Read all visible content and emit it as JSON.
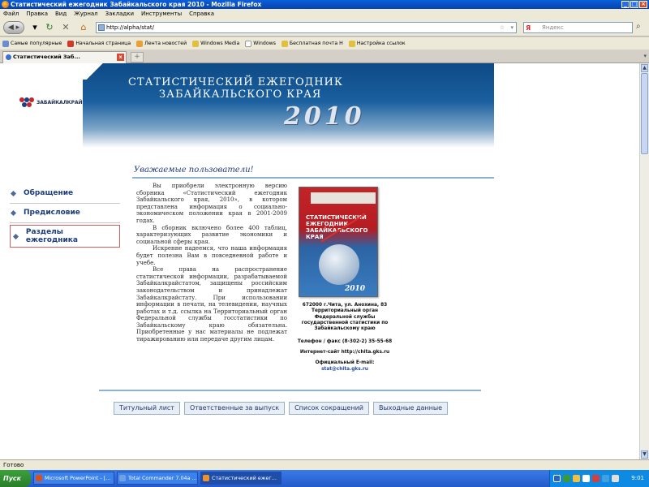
{
  "window": {
    "title": "Статистический ежегодник Забайкальского края 2010 - Mozilla Firefox"
  },
  "menu": [
    "Файл",
    "Правка",
    "Вид",
    "Журнал",
    "Закладки",
    "Инструменты",
    "Справка"
  ],
  "nav": {
    "url": "http://alpha/stat/",
    "search_placeholder": "Яндекс"
  },
  "bookmarks": [
    "Самые популярные",
    "Начальная страница",
    "Лента новостей",
    "Windows Media",
    "Windows",
    "Бесплатная почта H",
    "Настройка ссылок"
  ],
  "tab": {
    "label": "Статистический Заб..."
  },
  "page": {
    "logo_text": "ЗАБАЙКАЛКРАЙСТАТ",
    "banner_line1": "СТАТИСТИЧЕСКИЙ  ЕЖЕГОДНИК",
    "banner_line2": "ЗАБАЙКАЛЬСКОГО  КРАЯ",
    "banner_year": "2010",
    "welcome": "Уважаемые пользователи!",
    "sidebar": [
      "Обращение",
      "Предисловие",
      "Разделы ежегодника"
    ],
    "paragraphs": [
      "Вы приобрели электронную версию сборника «Статистический ежегодник Забайкальского края, 2010», в котором представлена информация о социально-экономическом положении края в 2001-2009 годах.",
      "В сборник включено более 400 таблиц, характеризующих развитие экономики и социальной сферы края.",
      "Искренне надеемся, что наша информация будет полезна Вам в повседневной работе и учебе.",
      "Все права на распространение статистической информации, разрабатываемой Забайкалкрайстатом, защищены российским законодательством и принадлежат Забайкалкрайстату. При использовании информации в печати, на телевидении, научных работах и т.д. ссылка на Территориальный орган Федеральной службы госстатистики по Забайкальскому краю обязательна. Приобретенные у нас материалы не подлежат тиражированию или передаче другим лицам."
    ],
    "book": {
      "title_l1": "СТАТИСТИЧЕСКИЙ",
      "title_l2": "ЕЖЕГОДНИК",
      "title_l3": "ЗАБАЙКАЛЬСКОГО",
      "title_l4": "КРАЯ",
      "year": "2010"
    },
    "contact": {
      "address": "672000 г.Чита, ул. Анохина, 83 Территориальный орган Федеральной службы государственной статистики по Забайкальскому краю",
      "phone": "Телефон / факс (8-302-2) 35-55-68",
      "site": "Интернет-сайт http://chita.gks.ru",
      "email_label": "Официальный E-mail:",
      "email": "stat@chita.gks.ru"
    },
    "buttons": [
      "Титульный лист",
      "Ответственные за выпуск",
      "Список сокращений",
      "Выходные данные"
    ]
  },
  "status": {
    "text": "Готово"
  },
  "taskbar": {
    "start": "Пуск",
    "tasks": [
      "Microsoft PowerPoint - [...",
      "Total Commander 7.04a ...",
      "Статистический ежег..."
    ],
    "clock": "9:01"
  }
}
